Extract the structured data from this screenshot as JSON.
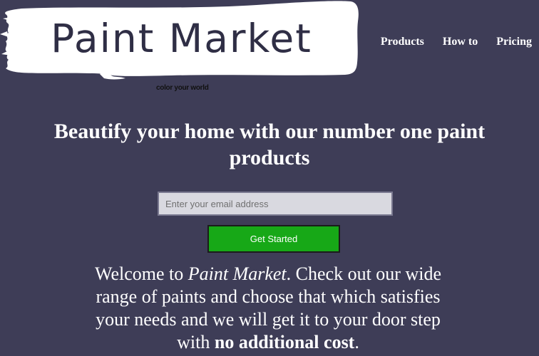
{
  "header": {
    "logo_text": "Paint Market",
    "tagline": "color your world",
    "nav": [
      "Products",
      "How to",
      "Pricing"
    ]
  },
  "hero": {
    "title": "Beautify your home with our number one paint products",
    "email_placeholder": "Enter your email address",
    "cta_label": "Get Started"
  },
  "welcome": {
    "prefix": "Welcome to ",
    "brand": "Paint Market",
    "middle": ". Check out our wide range of paints and choose that which satisfies your needs and we will get it to your door step with ",
    "emphasis": "no additional cost",
    "suffix": "."
  },
  "colors": {
    "background": "#3e3d57",
    "brush_stroke": "#ffffff",
    "cta": "#17a817"
  }
}
